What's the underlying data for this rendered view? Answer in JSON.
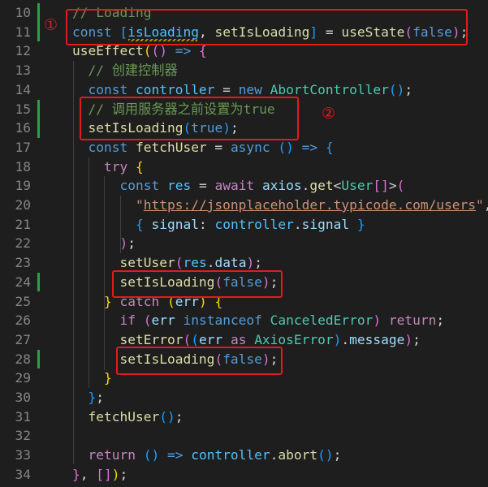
{
  "editor": {
    "colors": {
      "background": "#1e1e1e",
      "line_number": "#858585",
      "gutter_modified": "#2ea043",
      "annotation_red": "#e31b1b"
    },
    "annotations": {
      "badge_1": "①",
      "badge_2": "②"
    },
    "lines": [
      {
        "number": "10",
        "modified": true,
        "tokens": [
          {
            "t": "// Loading",
            "k": "comment"
          }
        ]
      },
      {
        "number": "11",
        "modified": true,
        "tokens": [
          {
            "t": "const ",
            "k": "keyword"
          },
          {
            "t": "[",
            "k": "bracket3"
          },
          {
            "t": "isLoading",
            "k": "const"
          },
          {
            "t": ", ",
            "k": "plain"
          },
          {
            "t": "setIsLoading",
            "k": "func"
          },
          {
            "t": "]",
            "k": "bracket3"
          },
          {
            "t": " = ",
            "k": "plain"
          },
          {
            "t": "useState",
            "k": "func"
          },
          {
            "t": "(",
            "k": "bracket2"
          },
          {
            "t": "false",
            "k": "keyword"
          },
          {
            "t": ")",
            "k": "bracket2"
          },
          {
            "t": ";",
            "k": "plain"
          }
        ]
      },
      {
        "number": "12",
        "modified": false,
        "tokens": [
          {
            "t": "useEffect",
            "k": "func"
          },
          {
            "t": "(",
            "k": "bracket1"
          },
          {
            "t": "()",
            "k": "bracket2"
          },
          {
            "t": " => ",
            "k": "keyword"
          },
          {
            "t": "{",
            "k": "bracket2"
          }
        ]
      },
      {
        "number": "13",
        "modified": false,
        "tokens": [
          {
            "t": "  // 创建控制器",
            "k": "comment"
          }
        ]
      },
      {
        "number": "14",
        "modified": false,
        "tokens": [
          {
            "t": "  const ",
            "k": "keyword"
          },
          {
            "t": "controller",
            "k": "const"
          },
          {
            "t": " = ",
            "k": "plain"
          },
          {
            "t": "new ",
            "k": "keyword"
          },
          {
            "t": "AbortController",
            "k": "type"
          },
          {
            "t": "()",
            "k": "bracket3"
          },
          {
            "t": ";",
            "k": "plain"
          }
        ]
      },
      {
        "number": "15",
        "modified": true,
        "tokens": [
          {
            "t": "  // 调用服务器之前设置为true",
            "k": "comment"
          }
        ]
      },
      {
        "number": "16",
        "modified": true,
        "tokens": [
          {
            "t": "  setIsLoading",
            "k": "func"
          },
          {
            "t": "(",
            "k": "bracket3"
          },
          {
            "t": "true",
            "k": "keyword"
          },
          {
            "t": ")",
            "k": "bracket3"
          },
          {
            "t": ";",
            "k": "plain"
          }
        ]
      },
      {
        "number": "17",
        "modified": false,
        "tokens": [
          {
            "t": "  const ",
            "k": "keyword"
          },
          {
            "t": "fetchUser",
            "k": "func"
          },
          {
            "t": " = ",
            "k": "plain"
          },
          {
            "t": "async ",
            "k": "keyword"
          },
          {
            "t": "()",
            "k": "bracket3"
          },
          {
            "t": " => ",
            "k": "keyword"
          },
          {
            "t": "{",
            "k": "bracket3"
          }
        ]
      },
      {
        "number": "18",
        "modified": false,
        "tokens": [
          {
            "t": "    try ",
            "k": "control"
          },
          {
            "t": "{",
            "k": "bracket1"
          }
        ]
      },
      {
        "number": "19",
        "modified": false,
        "tokens": [
          {
            "t": "      const ",
            "k": "keyword"
          },
          {
            "t": "res",
            "k": "const"
          },
          {
            "t": " = ",
            "k": "plain"
          },
          {
            "t": "await ",
            "k": "control"
          },
          {
            "t": "axios",
            "k": "var"
          },
          {
            "t": ".",
            "k": "plain"
          },
          {
            "t": "get",
            "k": "func"
          },
          {
            "t": "<",
            "k": "plain"
          },
          {
            "t": "User",
            "k": "type"
          },
          {
            "t": "[]",
            "k": "bracket2"
          },
          {
            "t": ">",
            "k": "plain"
          },
          {
            "t": "(",
            "k": "bracket2"
          }
        ]
      },
      {
        "number": "20",
        "modified": false,
        "tokens": [
          {
            "t": "        \"",
            "k": "string"
          },
          {
            "t": "https://jsonplaceholder.typicode.com/users",
            "k": "url"
          },
          {
            "t": "\"",
            "k": "string"
          },
          {
            "t": ",",
            "k": "plain"
          }
        ]
      },
      {
        "number": "21",
        "modified": false,
        "tokens": [
          {
            "t": "        ",
            "k": "plain"
          },
          {
            "t": "{",
            "k": "bracket3"
          },
          {
            "t": " signal",
            "k": "var"
          },
          {
            "t": ": ",
            "k": "plain"
          },
          {
            "t": "controller",
            "k": "const"
          },
          {
            "t": ".",
            "k": "plain"
          },
          {
            "t": "signal",
            "k": "var"
          },
          {
            "t": " }",
            "k": "bracket3"
          }
        ]
      },
      {
        "number": "22",
        "modified": false,
        "tokens": [
          {
            "t": "      ",
            "k": "plain"
          },
          {
            "t": ")",
            "k": "bracket2"
          },
          {
            "t": ";",
            "k": "plain"
          }
        ]
      },
      {
        "number": "23",
        "modified": false,
        "tokens": [
          {
            "t": "      setUser",
            "k": "func"
          },
          {
            "t": "(",
            "k": "bracket2"
          },
          {
            "t": "res",
            "k": "const"
          },
          {
            "t": ".",
            "k": "plain"
          },
          {
            "t": "data",
            "k": "var"
          },
          {
            "t": ")",
            "k": "bracket2"
          },
          {
            "t": ";",
            "k": "plain"
          }
        ]
      },
      {
        "number": "24",
        "modified": true,
        "tokens": [
          {
            "t": "      setIsLoading",
            "k": "func"
          },
          {
            "t": "(",
            "k": "bracket2"
          },
          {
            "t": "false",
            "k": "keyword"
          },
          {
            "t": ")",
            "k": "bracket2"
          },
          {
            "t": ";",
            "k": "plain"
          }
        ]
      },
      {
        "number": "25",
        "modified": false,
        "tokens": [
          {
            "t": "    ",
            "k": "plain"
          },
          {
            "t": "}",
            "k": "bracket1"
          },
          {
            "t": " catch ",
            "k": "control"
          },
          {
            "t": "(",
            "k": "bracket1"
          },
          {
            "t": "err",
            "k": "var"
          },
          {
            "t": ")",
            "k": "bracket1"
          },
          {
            "t": " ",
            "k": "plain"
          },
          {
            "t": "{",
            "k": "bracket1"
          }
        ]
      },
      {
        "number": "26",
        "modified": false,
        "tokens": [
          {
            "t": "      if ",
            "k": "control"
          },
          {
            "t": "(",
            "k": "bracket2"
          },
          {
            "t": "err",
            "k": "var"
          },
          {
            "t": " instanceof ",
            "k": "keyword"
          },
          {
            "t": "CanceledError",
            "k": "type"
          },
          {
            "t": ")",
            "k": "bracket2"
          },
          {
            "t": " return",
            "k": "control"
          },
          {
            "t": ";",
            "k": "plain"
          }
        ]
      },
      {
        "number": "27",
        "modified": false,
        "tokens": [
          {
            "t": "      setError",
            "k": "func"
          },
          {
            "t": "(",
            "k": "bracket2"
          },
          {
            "t": "(",
            "k": "bracket3"
          },
          {
            "t": "err",
            "k": "var"
          },
          {
            "t": " as ",
            "k": "control"
          },
          {
            "t": "AxiosError",
            "k": "type"
          },
          {
            "t": ")",
            "k": "bracket3"
          },
          {
            "t": ".",
            "k": "plain"
          },
          {
            "t": "message",
            "k": "var"
          },
          {
            "t": ")",
            "k": "bracket2"
          },
          {
            "t": ";",
            "k": "plain"
          }
        ]
      },
      {
        "number": "28",
        "modified": true,
        "tokens": [
          {
            "t": "      setIsLoading",
            "k": "func"
          },
          {
            "t": "(",
            "k": "bracket2"
          },
          {
            "t": "false",
            "k": "keyword"
          },
          {
            "t": ")",
            "k": "bracket2"
          },
          {
            "t": ";",
            "k": "plain"
          }
        ]
      },
      {
        "number": "29",
        "modified": false,
        "tokens": [
          {
            "t": "    ",
            "k": "plain"
          },
          {
            "t": "}",
            "k": "bracket1"
          }
        ]
      },
      {
        "number": "30",
        "modified": false,
        "tokens": [
          {
            "t": "  ",
            "k": "plain"
          },
          {
            "t": "}",
            "k": "bracket3"
          },
          {
            "t": ";",
            "k": "plain"
          }
        ]
      },
      {
        "number": "31",
        "modified": false,
        "tokens": [
          {
            "t": "  fetchUser",
            "k": "func"
          },
          {
            "t": "()",
            "k": "bracket3"
          },
          {
            "t": ";",
            "k": "plain"
          }
        ]
      },
      {
        "number": "32",
        "modified": false,
        "tokens": []
      },
      {
        "number": "33",
        "modified": false,
        "tokens": [
          {
            "t": "  return ",
            "k": "control"
          },
          {
            "t": "()",
            "k": "bracket3"
          },
          {
            "t": " => ",
            "k": "keyword"
          },
          {
            "t": "controller",
            "k": "const"
          },
          {
            "t": ".",
            "k": "plain"
          },
          {
            "t": "abort",
            "k": "func"
          },
          {
            "t": "()",
            "k": "bracket3"
          },
          {
            "t": ";",
            "k": "plain"
          }
        ]
      },
      {
        "number": "34",
        "modified": false,
        "tokens": [
          {
            "t": "}",
            "k": "bracket2"
          },
          {
            "t": ", ",
            "k": "plain"
          },
          {
            "t": "[]",
            "k": "bracket2"
          },
          {
            "t": ")",
            "k": "bracket1"
          },
          {
            "t": ";",
            "k": "plain"
          }
        ]
      }
    ]
  }
}
